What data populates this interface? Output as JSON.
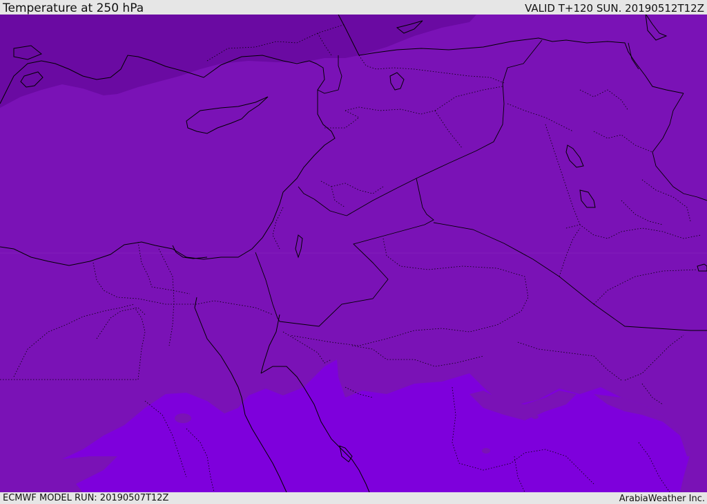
{
  "header": {
    "title": "Temperature at 250 hPa",
    "valid_time": "VALID T+120 SUN. 20190512T12Z"
  },
  "footer": {
    "model_run": "ECMWF MODEL RUN: 20190507T12Z",
    "credit": "ArabiaWeather Inc."
  },
  "colors": {
    "cold_band": "#6a0aa2",
    "mid_band": "#7a12b6",
    "warm_band": "#7e00dc",
    "boundary": "#000000"
  }
}
